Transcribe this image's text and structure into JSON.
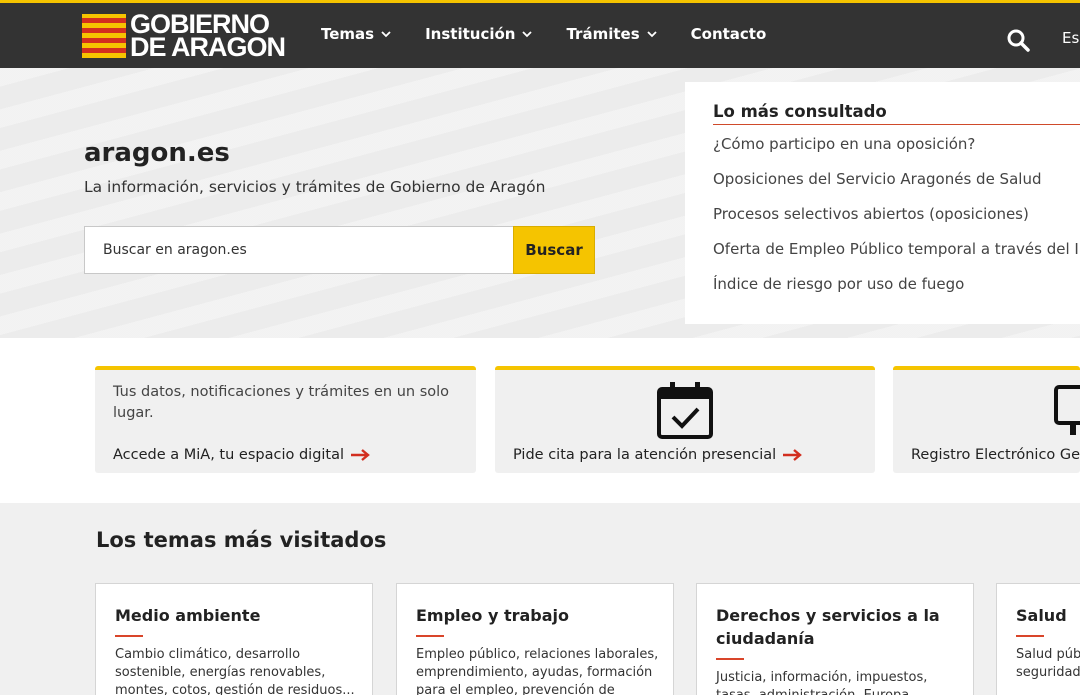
{
  "header": {
    "logo_line1": "GOBIERNO",
    "logo_line2": "DE ARAGON",
    "nav": [
      "Temas",
      "Institución",
      "Trámites",
      "Contacto"
    ],
    "lang": "Esp",
    "accent": "#f5c400"
  },
  "hero": {
    "title": "aragon.es",
    "subtitle": "La información, servicios y trámites de Gobierno de Aragón",
    "search_placeholder": "Buscar en aragon.es",
    "search_button": "Buscar"
  },
  "consulted": {
    "title": "Lo más consultado",
    "items": [
      "¿Cómo participo en una oposición?",
      "Oposiciones del Servicio Aragonés de Salud",
      "Procesos selectivos abiertos (oposiciones)",
      "Oferta de Empleo Público temporal a través del INAEM",
      "Índice de riesgo por uso de fuego"
    ]
  },
  "cards": [
    {
      "text": "Tus datos, notificaciones y trámites en un solo lugar.",
      "link": "Accede a MiA, tu espacio digital"
    },
    {
      "icon": "calendar-check-icon",
      "link": "Pide cita para la atención presencial"
    },
    {
      "icon": "monitor-icon",
      "link": "Registro Electrónico General"
    }
  ],
  "topics": {
    "title": "Los temas más visitados",
    "items": [
      {
        "title": "Medio ambiente",
        "desc": "Cambio climático, desarrollo sostenible, energías renovables, montes, cotos, gestión de residuos..."
      },
      {
        "title": "Empleo y trabajo",
        "desc": "Empleo público, relaciones laborales, emprendimiento, ayudas, formación para el empleo, prevención de riesgo..."
      },
      {
        "title": "Derechos y servicios a la ciudadanía",
        "desc": "Justicia, información, impuestos, tasas, administración, Europa, seguridad y..."
      },
      {
        "title": "Salud",
        "desc": "Salud pública, centros sanitarios, seguridad alimentaria..."
      }
    ]
  }
}
